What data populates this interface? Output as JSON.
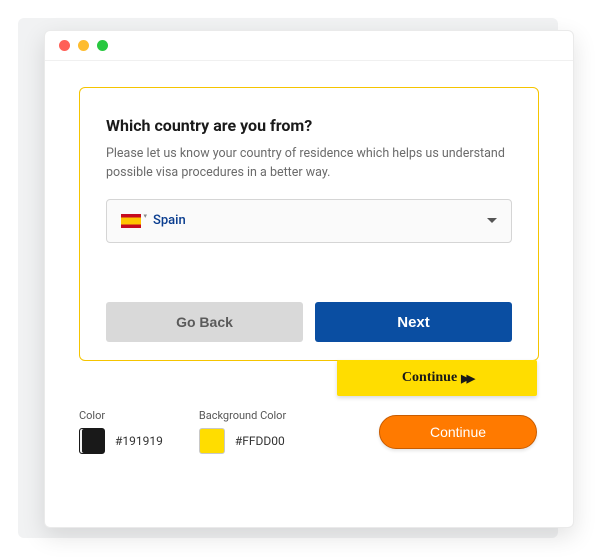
{
  "card": {
    "title": "Which country are you from?",
    "description": "Please let us know your country of residence which helps us understand possible visa procedures in a better way.",
    "select": {
      "value": "Spain"
    },
    "buttons": {
      "back": "Go Back",
      "next": "Next"
    }
  },
  "continue_yellow": "Continue",
  "continue_orange": "Continue",
  "colors": {
    "text_label": "Color",
    "text_value": "#191919",
    "bg_label": "Background Color",
    "bg_value": "#FFDD00"
  }
}
